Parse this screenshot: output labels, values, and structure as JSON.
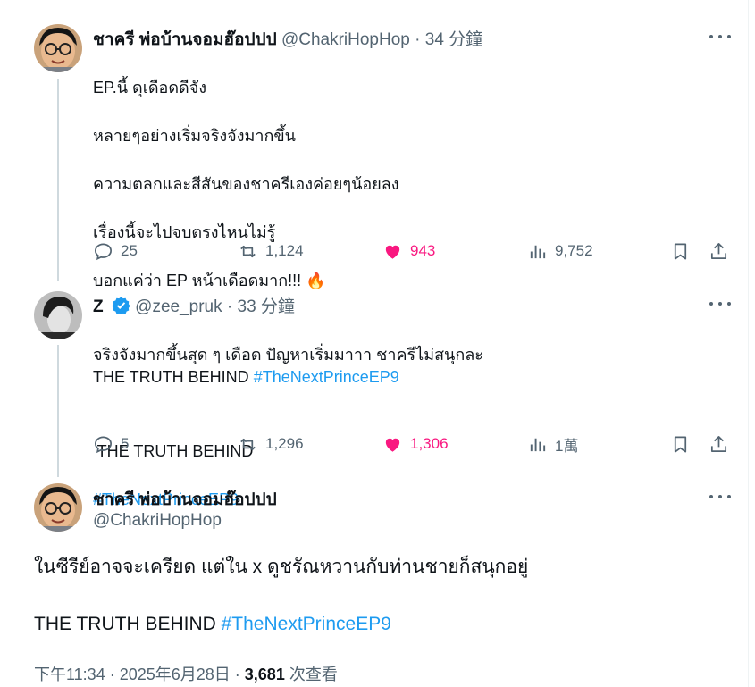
{
  "tweets": [
    {
      "name": "ชาครี พ่อบ้านจอมฮ๊อปปป",
      "handle": "@ChakriHopHop",
      "time": "34 分鐘",
      "lines": [
        "EP.นี้ ดุเดือดดีจัง",
        "หลายๆอย่างเริ่มจริงจังมากขึ้น",
        "ความตลกและสีสันของชาครีเองค่อยๆน้อยลง",
        "เรื่องนี้จะไปจบตรงไหนไม่รู้",
        "บอกแค่ว่า EP หน้าเดือดมาก!!! 🔥"
      ],
      "tag_line_prefix": "THE TRUTH BEHIND ",
      "hashtag": "#TheNextPrinceEP9",
      "replies": "25",
      "reposts": "1,124",
      "likes": "943",
      "views": "9,752"
    },
    {
      "name": "Z",
      "handle": "@zee_pruk",
      "time": "33 分鐘",
      "line1": "จริงจังมากขึ้นสุด ๆ เดือด ปัญหาเริ่มมาาา ชาครีไม่สนุกละ",
      "line2": " THE TRUTH BEHIND",
      "hashtag": "#TheNextPrinceEP9",
      "replies": "5",
      "reposts": "1,296",
      "likes": "1,306",
      "views": "1萬"
    }
  ],
  "main": {
    "name": "ชาครี พ่อบ้านจอมฮ๊อปปป",
    "handle": "@ChakriHopHop",
    "text": "ในซีรีย์อาจจะเครียด แต่ใน x ดูชรัณหวานกับท่านชายก็สนุกอยู่",
    "tag_line_prefix": "THE TRUTH BEHIND ",
    "hashtag": "#TheNextPrinceEP9",
    "meta_time": "下午11:34 · 2025年6月28日 · ",
    "meta_views": "3,681",
    "meta_views_label": " 次查看"
  },
  "colors": {
    "accent": "#1d9bf0",
    "like": "#f91880",
    "muted": "#536471"
  }
}
